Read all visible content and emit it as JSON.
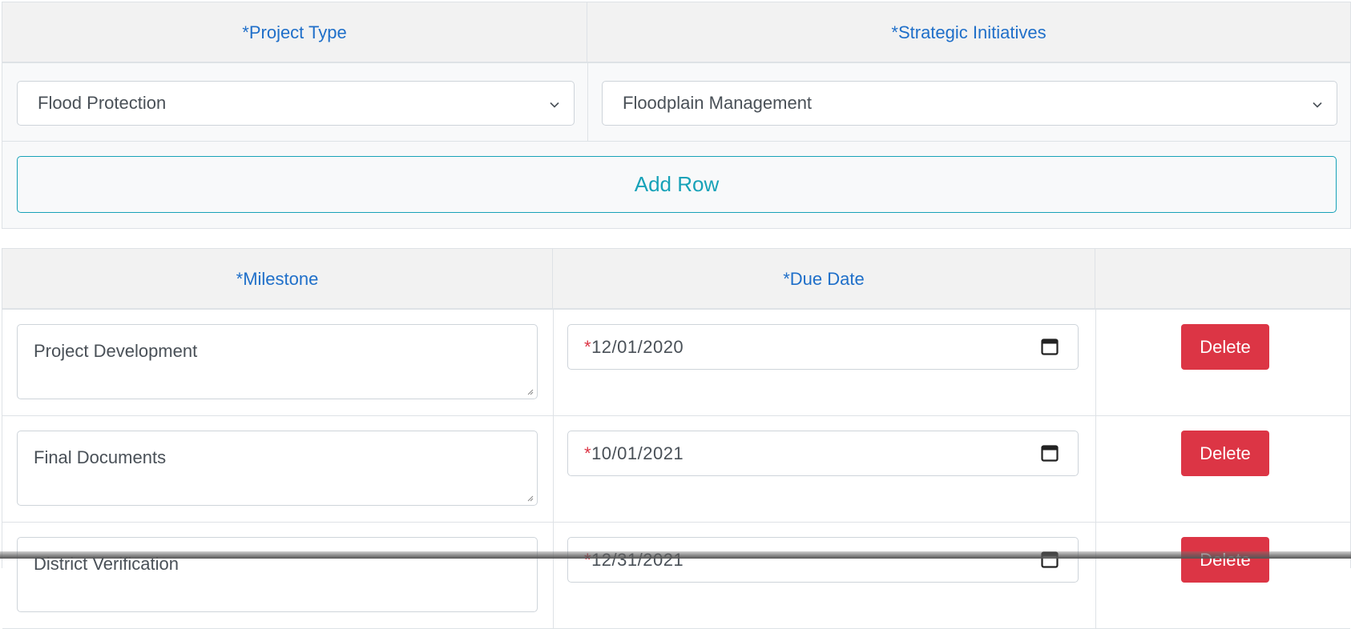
{
  "top_table": {
    "required_mark": "*",
    "col_project_type": "Project Type",
    "col_strategic_initiatives": "Strategic Initiatives",
    "project_type_value": "Flood Protection",
    "strategic_initiative_value": "Floodplain Management",
    "add_row_label": "Add Row"
  },
  "milestones": {
    "required_mark": "*",
    "col_milestone": "Milestone",
    "col_due_date": "Due Date",
    "rows": [
      {
        "milestone": "Project Development",
        "date_mark": "*",
        "due_date": "12/01/2020",
        "delete_label": "Delete"
      },
      {
        "milestone": "Final Documents",
        "date_mark": "*",
        "due_date": "10/01/2021",
        "delete_label": "Delete"
      },
      {
        "milestone": "District Verification",
        "date_mark": "*",
        "due_date": "12/31/2021",
        "delete_label": "Delete"
      }
    ]
  },
  "colors": {
    "header_text": "#1f6fc9",
    "required": "#dc3545",
    "outline_info": "#17a2b8",
    "danger": "#dc3545"
  },
  "icons": [
    "chevron-down-icon",
    "calendar-icon",
    "resize-grip-icon"
  ]
}
